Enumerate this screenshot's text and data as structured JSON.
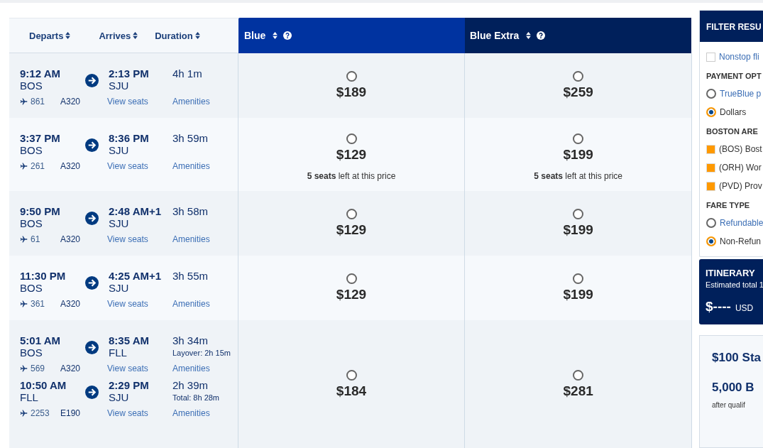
{
  "columns": {
    "departs": "Departs",
    "arrives": "Arrives",
    "duration": "Duration",
    "fares": [
      {
        "name": "Blue",
        "kind": "blue"
      },
      {
        "name": "Blue Extra",
        "kind": "extra"
      }
    ]
  },
  "flights": [
    {
      "segments": [
        {
          "depart_time": "9:12 AM",
          "depart_airport": "BOS",
          "arrive_time": "2:13 PM",
          "arrive_airport": "SJU",
          "duration": "4h 1m",
          "flight_number": "861",
          "aircraft": "A320",
          "view_seats": "View seats",
          "amenities": "Amenities"
        }
      ],
      "fares": [
        {
          "price": "$189",
          "selected": false
        },
        {
          "price": "$259",
          "selected": false
        }
      ]
    },
    {
      "segments": [
        {
          "depart_time": "3:37 PM",
          "depart_airport": "BOS",
          "arrive_time": "8:36 PM",
          "arrive_airport": "SJU",
          "duration": "3h 59m",
          "flight_number": "261",
          "aircraft": "A320",
          "view_seats": "View seats",
          "amenities": "Amenities"
        }
      ],
      "fares": [
        {
          "price": "$129",
          "selected": false,
          "seats_note": "**5 seats** left at this price"
        },
        {
          "price": "$199",
          "selected": false,
          "seats_note": "**5 seats** left at this price"
        }
      ]
    },
    {
      "segments": [
        {
          "depart_time": "9:50 PM",
          "depart_airport": "BOS",
          "arrive_time": "2:48 AM+1",
          "arrive_airport": "SJU",
          "duration": "3h 58m",
          "flight_number": "61",
          "aircraft": "A320",
          "view_seats": "View seats",
          "amenities": "Amenities"
        }
      ],
      "fares": [
        {
          "price": "$129",
          "selected": false
        },
        {
          "price": "$199",
          "selected": false
        }
      ]
    },
    {
      "segments": [
        {
          "depart_time": "11:30 PM",
          "depart_airport": "BOS",
          "arrive_time": "4:25 AM+1",
          "arrive_airport": "SJU",
          "duration": "3h 55m",
          "flight_number": "361",
          "aircraft": "A320",
          "view_seats": "View seats",
          "amenities": "Amenities"
        }
      ],
      "fares": [
        {
          "price": "$129",
          "selected": false
        },
        {
          "price": "$199",
          "selected": false
        }
      ]
    },
    {
      "segments": [
        {
          "depart_time": "5:01 AM",
          "depart_airport": "BOS",
          "arrive_time": "8:35 AM",
          "arrive_airport": "FLL",
          "duration": "3h 34m",
          "note": "Layover: 2h 15m",
          "flight_number": "569",
          "aircraft": "A320",
          "view_seats": "View seats",
          "amenities": "Amenities"
        },
        {
          "depart_time": "10:50 AM",
          "depart_airport": "FLL",
          "arrive_time": "2:29 PM",
          "arrive_airport": "SJU",
          "duration": "2h 39m",
          "note": "Total: 8h 28m",
          "flight_number": "2253",
          "aircraft": "E190",
          "view_seats": "View seats",
          "amenities": "Amenities"
        }
      ],
      "fares": [
        {
          "price": "$184",
          "selected": false
        },
        {
          "price": "$281",
          "selected": false
        }
      ]
    }
  ],
  "filter": {
    "title": "FILTER RESU",
    "nonstop": {
      "label": "Nonstop fli",
      "checked": false
    },
    "groups": [
      {
        "title": "PAYMENT OPT",
        "kind": "radio",
        "options": [
          {
            "label": "TrueBlue p",
            "selected": false
          },
          {
            "label": "Dollars",
            "selected": true
          }
        ]
      },
      {
        "title": "BOSTON ARE",
        "kind": "checkbox",
        "options": [
          {
            "label": "(BOS) Bost",
            "checked": true
          },
          {
            "label": "(ORH) Wor",
            "checked": true
          },
          {
            "label": "(PVD) Prov",
            "checked": true
          }
        ]
      },
      {
        "title": "FARE TYPE",
        "kind": "radio",
        "options": [
          {
            "label": "Refundable",
            "selected": false
          },
          {
            "label": "Non-Refun",
            "selected": true
          }
        ]
      }
    ]
  },
  "itinerary": {
    "title": "ITINERARY",
    "subtitle": "Estimated total 1",
    "amount": "$----",
    "currency": "USD"
  },
  "promo": {
    "headline": "$100 Sta",
    "points": "5,000 B",
    "note": "after qualif"
  }
}
